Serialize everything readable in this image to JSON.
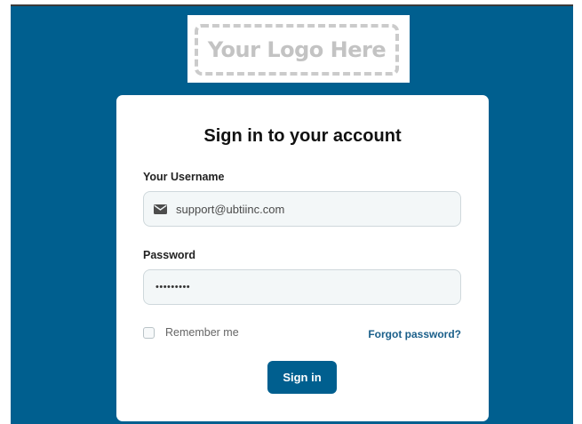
{
  "logo": {
    "text": "Your Logo Here"
  },
  "login": {
    "title": "Sign in to your account",
    "username_label": "Your Username",
    "username_value": "support@ubtiinc.com",
    "password_label": "Password",
    "password_value": "•••••••••",
    "remember_label": "Remember me",
    "remember_checked": false,
    "forgot_label": "Forgot password?",
    "signin_label": "Sign in"
  },
  "colors": {
    "background": "#005f8f",
    "button": "#005f8f",
    "link": "#1a5f8a",
    "card": "#ffffff"
  },
  "icons": {
    "username_icon": "mail-icon"
  }
}
